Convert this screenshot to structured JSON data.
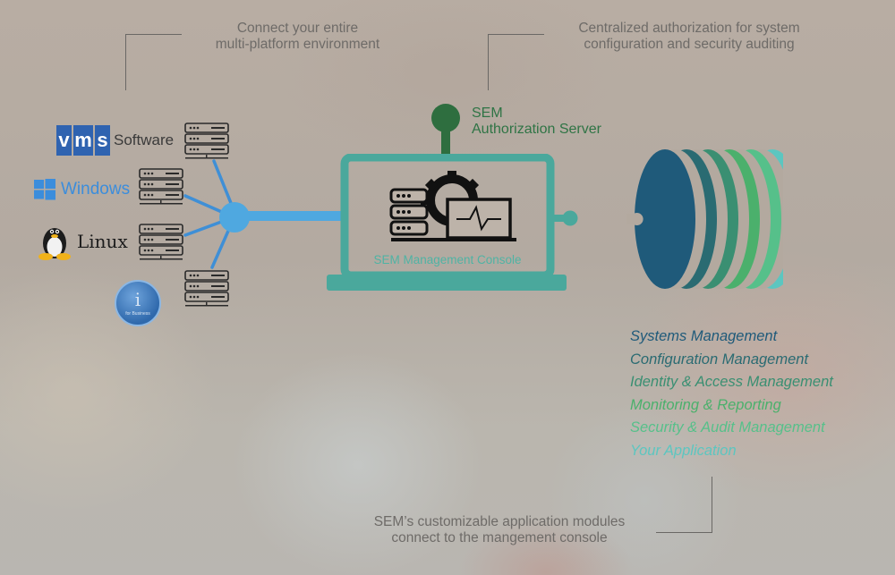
{
  "captions": {
    "connect_line1": "Connect your entire",
    "connect_line2": "multi-platform environment",
    "auth_line1": "Centralized authorization for system",
    "auth_line2": "configuration and security auditing",
    "modules_line1": "SEM’s customizable application modules",
    "modules_line2": "connect to the mangement console"
  },
  "platforms": {
    "vms": {
      "logo_letters": [
        "v",
        "m",
        "s"
      ],
      "label": "Software",
      "color": "#2f63b0"
    },
    "windows": {
      "label": "Windows",
      "color": "#3b8ddc"
    },
    "linux": {
      "label": "Linux"
    },
    "ibmi": {
      "label": "for Business",
      "glyph": "i"
    }
  },
  "auth_server": {
    "line1": "SEM",
    "line2": "Authorization Server",
    "color": "#2e6e3f"
  },
  "console": {
    "label": "SEM Management Console",
    "color": "#4aa89c"
  },
  "hub": {
    "color": "#4fa8e0"
  },
  "modules": [
    {
      "label": "Systems Management",
      "color": "#1f5a7a"
    },
    {
      "label": "Configuration Management",
      "color": "#2a6b72"
    },
    {
      "label": "Identity & Access Management",
      "color": "#3a8f72"
    },
    {
      "label": "Monitoring & Reporting",
      "color": "#4bb06c"
    },
    {
      "label": "Security & Audit Management",
      "color": "#56c08a"
    },
    {
      "label": "Your Application",
      "color": "#5cc6c0"
    }
  ]
}
